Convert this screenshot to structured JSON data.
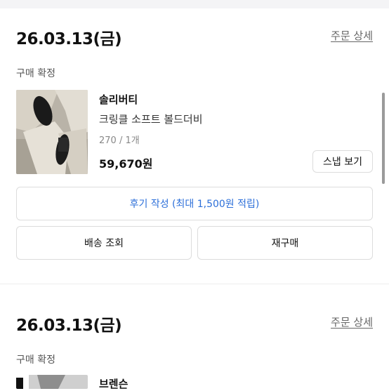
{
  "orders": [
    {
      "date": "26.03.13(금)",
      "detail_link": "주문 상세",
      "status": "구매 확정",
      "product": {
        "brand": "솔리버티",
        "name": "크링클 소프트 볼드더비",
        "option": "270 / 1개",
        "price": "59,670원",
        "snap_button": "스냅 보기"
      },
      "review_button": "후기 작성 (최대 1,500원 적립)",
      "shipping_button": "배송 조회",
      "reorder_button": "재구매"
    },
    {
      "date": "26.03.13(금)",
      "detail_link": "주문 상세",
      "status": "구매 확정",
      "product": {
        "brand": "브렌슨"
      }
    }
  ]
}
